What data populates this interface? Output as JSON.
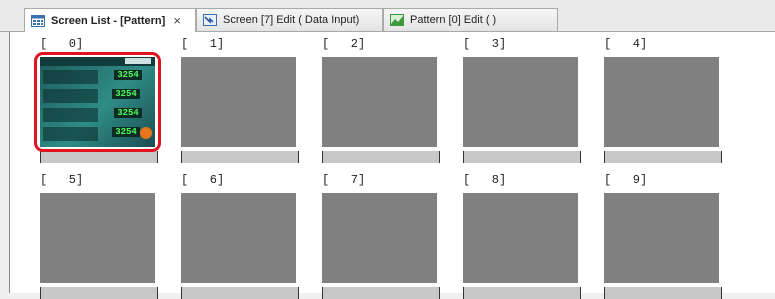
{
  "tabs": [
    {
      "label": "Screen List - [Pattern]",
      "close": "×",
      "icon": "screen-list-icon",
      "active": true
    },
    {
      "label": "Screen [7] Edit (      Data Input)",
      "icon": "screen-edit-icon",
      "active": false
    },
    {
      "label": "Pattern [0] Edit (            )",
      "icon": "pattern-edit-icon",
      "active": false
    }
  ],
  "patterns": [
    {
      "label": "[   0]"
    },
    {
      "label": "[   1]"
    },
    {
      "label": "[   2]"
    },
    {
      "label": "[   3]"
    },
    {
      "label": "[   4]"
    },
    {
      "label": "[   5]"
    },
    {
      "label": "[   6]"
    },
    {
      "label": "[   7]"
    },
    {
      "label": "[   8]"
    },
    {
      "label": "[   9]"
    }
  ],
  "preview": {
    "values": [
      "3254",
      "3254",
      "3254",
      "3254"
    ]
  },
  "colors": {
    "selection": "#e0141e",
    "thumbnail": "#808080",
    "name_bar": "#c8c8c8"
  }
}
